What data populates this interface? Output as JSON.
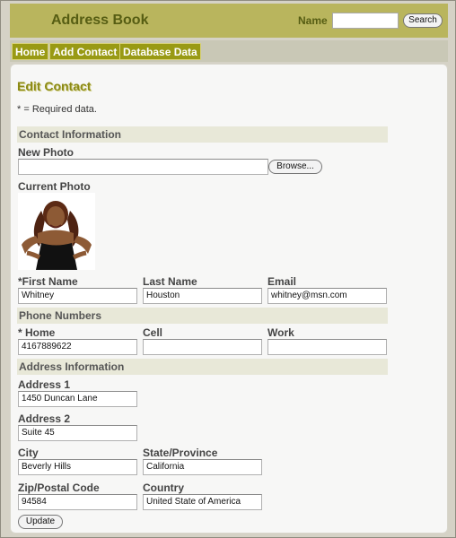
{
  "header": {
    "title": "Address Book",
    "search_label": "Name",
    "search_value": "",
    "search_button": "Search"
  },
  "nav": {
    "items": [
      {
        "label": "Home"
      },
      {
        "label": "Add Contact"
      },
      {
        "label": "Database Data"
      }
    ]
  },
  "form": {
    "title": "Edit Contact",
    "required_note": "* = Required data.",
    "contact_section": "Contact Information",
    "new_photo_label": "New Photo",
    "browse_button": "Browse...",
    "current_photo_label": "Current Photo",
    "first_name_label": "*First Name",
    "first_name_value": "Whitney",
    "last_name_label": "Last Name",
    "last_name_value": "Houston",
    "email_label": "Email",
    "email_value": "whitney@msn.com",
    "phone_section": "Phone Numbers",
    "home_label": "* Home",
    "home_value": "4167889622",
    "cell_label": "Cell",
    "cell_value": "",
    "work_label": "Work",
    "work_value": "",
    "address_section": "Address Information",
    "address1_label": "Address 1",
    "address1_value": "1450 Duncan Lane",
    "address2_label": "Address 2",
    "address2_value": "Suite 45",
    "city_label": "City",
    "city_value": "Beverly Hills",
    "state_label": "State/Province",
    "state_value": "California",
    "zip_label": "Zip/Postal Code",
    "zip_value": "94584",
    "country_label": "Country",
    "country_value": "United State of America",
    "update_button": "Update"
  },
  "colors": {
    "header_bg": "#b9b55d",
    "nav_item_bg": "#999a14",
    "title_text": "#8c8a15",
    "section_bg": "#e8e8d8"
  }
}
